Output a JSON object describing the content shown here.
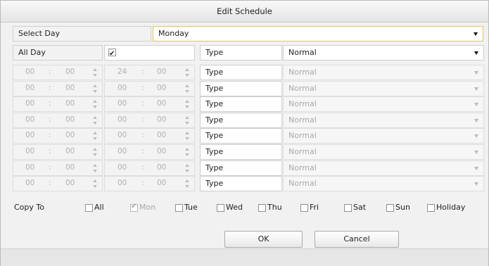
{
  "dialog": {
    "title": "Edit Schedule"
  },
  "select_day": {
    "label": "Select Day",
    "value": "Monday"
  },
  "all_day": {
    "label": "All Day",
    "checked": true,
    "type_label": "Type",
    "type_value": "Normal"
  },
  "segments": [
    {
      "start_h": "00",
      "start_m": "00",
      "end_h": "24",
      "end_m": "00",
      "type_label": "Type",
      "type_value": "Normal"
    },
    {
      "start_h": "00",
      "start_m": "00",
      "end_h": "00",
      "end_m": "00",
      "type_label": "Type",
      "type_value": "Normal"
    },
    {
      "start_h": "00",
      "start_m": "00",
      "end_h": "00",
      "end_m": "00",
      "type_label": "Type",
      "type_value": "Normal"
    },
    {
      "start_h": "00",
      "start_m": "00",
      "end_h": "00",
      "end_m": "00",
      "type_label": "Type",
      "type_value": "Normal"
    },
    {
      "start_h": "00",
      "start_m": "00",
      "end_h": "00",
      "end_m": "00",
      "type_label": "Type",
      "type_value": "Normal"
    },
    {
      "start_h": "00",
      "start_m": "00",
      "end_h": "00",
      "end_m": "00",
      "type_label": "Type",
      "type_value": "Normal"
    },
    {
      "start_h": "00",
      "start_m": "00",
      "end_h": "00",
      "end_m": "00",
      "type_label": "Type",
      "type_value": "Normal"
    },
    {
      "start_h": "00",
      "start_m": "00",
      "end_h": "00",
      "end_m": "00",
      "type_label": "Type",
      "type_value": "Normal"
    }
  ],
  "time_separator": ":",
  "copy_to": {
    "label": "Copy To",
    "days": [
      {
        "label": "All",
        "checked": false,
        "disabled": false
      },
      {
        "label": "Mon",
        "checked": true,
        "disabled": true
      },
      {
        "label": "Tue",
        "checked": false,
        "disabled": false
      },
      {
        "label": "Wed",
        "checked": false,
        "disabled": false
      },
      {
        "label": "Thu",
        "checked": false,
        "disabled": false
      },
      {
        "label": "Fri",
        "checked": false,
        "disabled": false
      },
      {
        "label": "Sat",
        "checked": false,
        "disabled": false
      },
      {
        "label": "Sun",
        "checked": false,
        "disabled": false
      },
      {
        "label": "Holiday",
        "checked": false,
        "disabled": false
      }
    ]
  },
  "buttons": {
    "ok": "OK",
    "cancel": "Cancel"
  }
}
